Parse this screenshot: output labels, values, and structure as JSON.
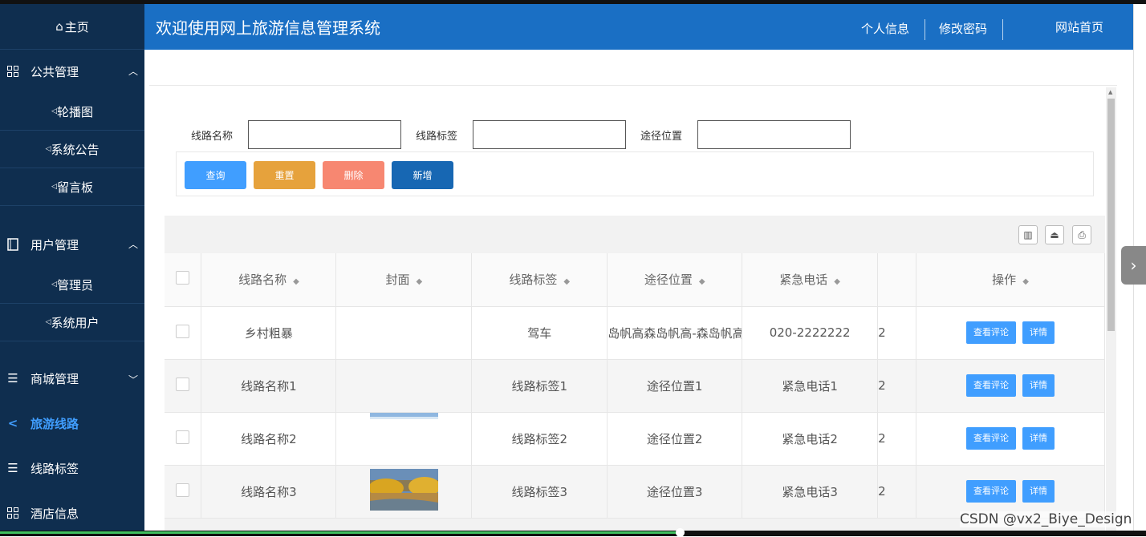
{
  "header": {
    "title": "欢迎使用网上旅游信息管理系统",
    "nav": [
      "个人信息",
      "修改密码",
      "网站首页"
    ]
  },
  "sidebar": {
    "home": "主页",
    "groups": [
      {
        "label": "公共管理",
        "icon": "grid-icon",
        "expanded": true,
        "items": [
          "轮播图",
          "系统公告",
          "留言板"
        ]
      },
      {
        "label": "用户管理",
        "icon": "book-icon",
        "expanded": true,
        "items": [
          "管理员",
          "系统用户"
        ]
      },
      {
        "label": "商城管理",
        "icon": "list-icon",
        "expanded": false,
        "items": []
      },
      {
        "label": "旅游线路",
        "icon": "share-icon",
        "active": true,
        "items": []
      },
      {
        "label": "线路标签",
        "icon": "list-icon",
        "items": []
      },
      {
        "label": "酒店信息",
        "icon": "grid-icon",
        "items": []
      }
    ]
  },
  "search": {
    "fields": [
      {
        "label": "线路名称",
        "value": ""
      },
      {
        "label": "线路标签",
        "value": ""
      },
      {
        "label": "途径位置",
        "value": ""
      }
    ],
    "buttons": [
      {
        "label": "查询",
        "color": "#409eff"
      },
      {
        "label": "重置",
        "color": "#e6a23c"
      },
      {
        "label": "删除",
        "color": "#f78771"
      },
      {
        "label": "新增",
        "color": "#1767b3"
      }
    ]
  },
  "table": {
    "columns": [
      "线路名称",
      "封面",
      "线路标签",
      "途径位置",
      "紧急电话",
      "操作"
    ],
    "rows": [
      {
        "name": "乡村粗暴",
        "cover": "",
        "tag": "驾车",
        "location": "岛帆高森岛帆高-森岛帆高",
        "phone": "020-2222222",
        "extra": "2"
      },
      {
        "name": "线路名称1",
        "cover": "",
        "tag": "线路标签1",
        "location": "途径位置1",
        "phone": "紧急电话1",
        "extra": "2"
      },
      {
        "name": "线路名称2",
        "cover": "sky-image",
        "tag": "线路标签2",
        "location": "途径位置2",
        "phone": "紧急电话2",
        "extra": "2"
      },
      {
        "name": "线路名称3",
        "cover": "autumn-image",
        "tag": "线路标签3",
        "location": "途径位置3",
        "phone": "紧急电话3",
        "extra": "2"
      }
    ],
    "row_actions": [
      "查看评论",
      "详情"
    ]
  },
  "watermark": "CSDN @vx2_Biye_Design",
  "colors": {
    "sidebar_bg": "#0f2e4f",
    "header_bg": "#1a6fc4",
    "accent": "#409eff"
  }
}
